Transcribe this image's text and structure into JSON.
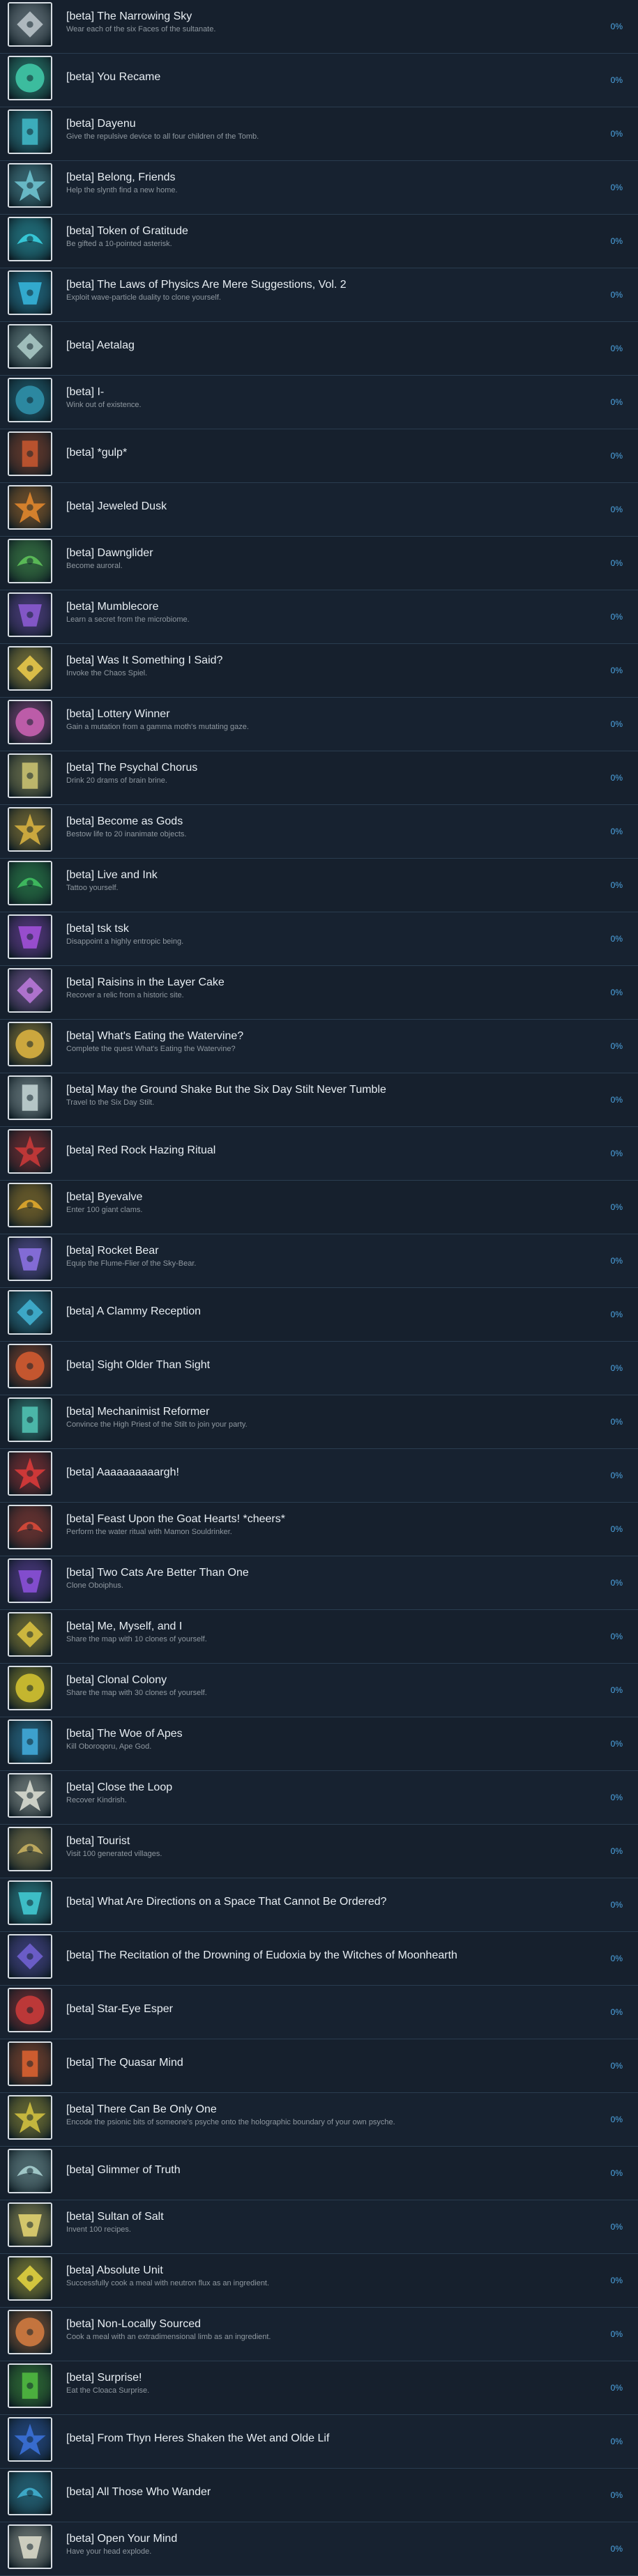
{
  "colors": {
    "background": "#1b2838",
    "row_background": "#16202d",
    "title": "#e8eef3",
    "description": "#8f98a0",
    "percent": "#4fa9e8",
    "icon_border": "#d7dde3"
  },
  "achievements": [
    {
      "title": "[beta] The Narrowing Sky",
      "description": "Wear each of the six Faces of the sultanate.",
      "percent": "0%",
      "icon": "mask-icon",
      "color": "#b8c2c8"
    },
    {
      "title": "[beta] You Recame",
      "description": "",
      "percent": "0%",
      "icon": "sun-face-icon",
      "color": "#3fc7a6"
    },
    {
      "title": "[beta] Dayenu",
      "description": "Give the repulsive device to all four children of the Tomb.",
      "percent": "0%",
      "icon": "bottle-icon",
      "color": "#3fb6c4"
    },
    {
      "title": "[beta] Belong, Friends",
      "description": "Help the slynth find a new home.",
      "percent": "0%",
      "icon": "creature-icon",
      "color": "#6ec2cf"
    },
    {
      "title": "[beta] Token of Gratitude",
      "description": "Be gifted a 10-pointed asterisk.",
      "percent": "0%",
      "icon": "asterisk-icon",
      "color": "#38d0e0"
    },
    {
      "title": "[beta] The Laws of Physics Are Mere Suggestions, Vol. 2",
      "description": "Exploit wave-particle duality to clone yourself.",
      "percent": "0%",
      "icon": "wave-icon",
      "color": "#35b3d8"
    },
    {
      "title": "[beta] Aetalag",
      "description": "",
      "percent": "0%",
      "icon": "figure-icon",
      "color": "#a8c8c4"
    },
    {
      "title": "[beta] I-",
      "description": "Wink out of existence.",
      "percent": "0%",
      "icon": "fade-icon",
      "color": "#2f8fa8"
    },
    {
      "title": "[beta] *gulp*",
      "description": "",
      "percent": "0%",
      "icon": "gut-icon",
      "color": "#c3552f"
    },
    {
      "title": "[beta] Jeweled Dusk",
      "description": "",
      "percent": "0%",
      "icon": "gem-icon",
      "color": "#e0862c"
    },
    {
      "title": "[beta] Dawnglider",
      "description": "Become auroral.",
      "percent": "0%",
      "icon": "aurora-icon",
      "color": "#5ec25a"
    },
    {
      "title": "[beta] Mumblecore",
      "description": "Learn a secret from the microbiome.",
      "percent": "0%",
      "icon": "microbe-icon",
      "color": "#8a5ad0"
    },
    {
      "title": "[beta] Was It Something I Said?",
      "description": "Invoke the Chaos Spiel.",
      "percent": "0%",
      "icon": "glyph-icon",
      "color": "#e8c84a"
    },
    {
      "title": "[beta] Lottery Winner",
      "description": "Gain a mutation from a gamma moth's mutating gaze.",
      "percent": "0%",
      "icon": "grid-icon",
      "color": "#c860b0"
    },
    {
      "title": "[beta] The Psychal Chorus",
      "description": "Drink 20 drams of brain brine.",
      "percent": "0%",
      "icon": "brain-icon",
      "color": "#c8c070"
    },
    {
      "title": "[beta] Become as Gods",
      "description": "Bestow life to 20 inanimate objects.",
      "percent": "0%",
      "icon": "statue-icon",
      "color": "#d6b040"
    },
    {
      "title": "[beta] Live and Ink",
      "description": "Tattoo yourself.",
      "percent": "0%",
      "icon": "ink-icon",
      "color": "#40c060"
    },
    {
      "title": "[beta] tsk tsk",
      "description": "Disappoint a highly entropic being.",
      "percent": "0%",
      "icon": "triangle-icon",
      "color": "#a050d8"
    },
    {
      "title": "[beta] Raisins in the Layer Cake",
      "description": "Recover a relic from a historic site.",
      "percent": "0%",
      "icon": "relic-icon",
      "color": "#b878d8"
    },
    {
      "title": "[beta] What's Eating the Watervine?",
      "description": "Complete the quest What's Eating the Watervine?",
      "percent": "0%",
      "icon": "farmer-icon",
      "color": "#d8b040"
    },
    {
      "title": "[beta] May the Ground Shake But the Six Day Stilt Never Tumble",
      "description": "Travel to the Six Day Stilt.",
      "percent": "0%",
      "icon": "tower-icon",
      "color": "#c0d0d0"
    },
    {
      "title": "[beta] Red Rock Hazing Ritual",
      "description": "",
      "percent": "0%",
      "icon": "rock-icon",
      "color": "#c83838"
    },
    {
      "title": "[beta] Byevalve",
      "description": "Enter 100 giant clams.",
      "percent": "0%",
      "icon": "ticket-icon",
      "color": "#e0a82c"
    },
    {
      "title": "[beta] Rocket Bear",
      "description": "Equip the Flume-Flier of the Sky-Bear.",
      "percent": "0%",
      "icon": "rocket-icon",
      "color": "#8a70e0"
    },
    {
      "title": "[beta] A Clammy Reception",
      "description": "",
      "percent": "0%",
      "icon": "clam-icon",
      "color": "#40b0d0"
    },
    {
      "title": "[beta] Sight Older Than Sight",
      "description": "",
      "percent": "0%",
      "icon": "eye-icon",
      "color": "#d05a30"
    },
    {
      "title": "[beta] Mechanimist Reformer",
      "description": "Convince the High Priest of the Stilt to join your party.",
      "percent": "0%",
      "icon": "priest-icon",
      "color": "#50c0b0"
    },
    {
      "title": "[beta] Aaaaaaaaaargh!",
      "description": "",
      "percent": "0%",
      "icon": "scream-icon",
      "color": "#d83a3a"
    },
    {
      "title": "[beta] Feast Upon the Goat Hearts! *cheers*",
      "description": "Perform the water ritual with Mamon Souldrinker.",
      "percent": "0%",
      "icon": "goat-icon",
      "color": "#d84a3a"
    },
    {
      "title": "[beta] Two Cats Are Better Than One",
      "description": "Clone Oboiphus.",
      "percent": "0%",
      "icon": "cat-icon",
      "color": "#8a50d8"
    },
    {
      "title": "[beta] Me, Myself, and I",
      "description": "Share the map with 10 clones of yourself.",
      "percent": "0%",
      "icon": "clones-icon",
      "color": "#d8c040"
    },
    {
      "title": "[beta] Clonal Colony",
      "description": "Share the map with 30 clones of yourself.",
      "percent": "0%",
      "icon": "colony-icon",
      "color": "#d0c030"
    },
    {
      "title": "[beta] The Woe of Apes",
      "description": "Kill Oboroqoru, Ape God.",
      "percent": "0%",
      "icon": "ape-icon",
      "color": "#40a8d8"
    },
    {
      "title": "[beta] Close the Loop",
      "description": "Recover Kindrish.",
      "percent": "0%",
      "icon": "loop-icon",
      "color": "#d8dcd0"
    },
    {
      "title": "[beta] Tourist",
      "description": "Visit 100 generated villages.",
      "percent": "0%",
      "icon": "signpost-icon",
      "color": "#c8b060"
    },
    {
      "title": "[beta] What Are Directions on a Space That Cannot Be Ordered?",
      "description": "",
      "percent": "0%",
      "icon": "diamond-icon",
      "color": "#40c8d0"
    },
    {
      "title": "[beta] The Recitation of the Drowning of Eudoxia by the Witches of Moonhearth",
      "description": "",
      "percent": "0%",
      "icon": "moon-icon",
      "color": "#7060d0"
    },
    {
      "title": "[beta] Star-Eye Esper",
      "description": "",
      "percent": "0%",
      "icon": "star-eye-icon",
      "color": "#c83a3a"
    },
    {
      "title": "[beta] The Quasar Mind",
      "description": "",
      "percent": "0%",
      "icon": "quasar-icon",
      "color": "#d86030"
    },
    {
      "title": "[beta] There Can Be Only One",
      "description": "Encode the psionic bits of someone's psyche onto the holographic boundary of your own psyche.",
      "percent": "0%",
      "icon": "psyche-icon",
      "color": "#d0c040"
    },
    {
      "title": "[beta] Glimmer of Truth",
      "description": "",
      "percent": "0%",
      "icon": "glimmer-icon",
      "color": "#a8d0d0"
    },
    {
      "title": "[beta] Sultan of Salt",
      "description": "Invent 100 recipes.",
      "percent": "0%",
      "icon": "salt-icon",
      "color": "#e0d070"
    },
    {
      "title": "[beta] Absolute Unit",
      "description": "Successfully cook a meal with neutron flux as an ingredient.",
      "percent": "0%",
      "icon": "atom-icon",
      "color": "#e0d040"
    },
    {
      "title": "[beta] Non-Locally Sourced",
      "description": "Cook a meal with an extradimensional limb as an ingredient.",
      "percent": "0%",
      "icon": "limb-icon",
      "color": "#d07a40"
    },
    {
      "title": "[beta] Surprise!",
      "description": "Eat the Cloaca Surprise.",
      "percent": "0%",
      "icon": "bowl-icon",
      "color": "#50b840"
    },
    {
      "title": "[beta] From Thyn Heres Shaken the Wet and Olde Lif",
      "description": "",
      "percent": "0%",
      "icon": "eel-icon",
      "color": "#3a70d8"
    },
    {
      "title": "[beta] All Those Who Wander",
      "description": "",
      "percent": "0%",
      "icon": "wander-icon",
      "color": "#40b0d0"
    },
    {
      "title": "[beta] Open Your Mind",
      "description": "Have your head explode.",
      "percent": "0%",
      "icon": "skull-icon",
      "color": "#d8d8c8"
    }
  ]
}
